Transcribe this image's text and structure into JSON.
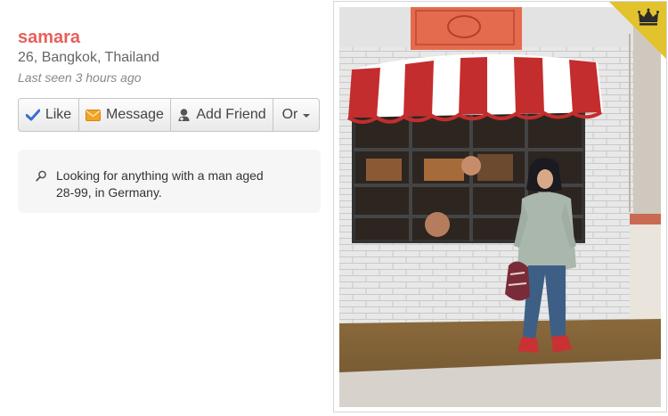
{
  "profile": {
    "name": "samara",
    "details": "26, Bangkok, Thailand",
    "last_seen": "Last seen 3 hours ago"
  },
  "actions": {
    "like": "Like",
    "message": "Message",
    "add_friend": "Add Friend",
    "more": "Or"
  },
  "looking_for": {
    "text": "Looking for anything with a man aged 28-99, in Germany."
  },
  "icons": {
    "like": "checkmark-icon",
    "message": "envelope-icon",
    "add_friend": "add-person-icon",
    "more": "caret-down-icon",
    "looking": "magnifier-icon",
    "badge": "crown-icon"
  },
  "colors": {
    "name": "#e8605b",
    "like_check": "#3a6fcf",
    "message_icon": "#f0a326",
    "badge": "#e2c22d"
  }
}
